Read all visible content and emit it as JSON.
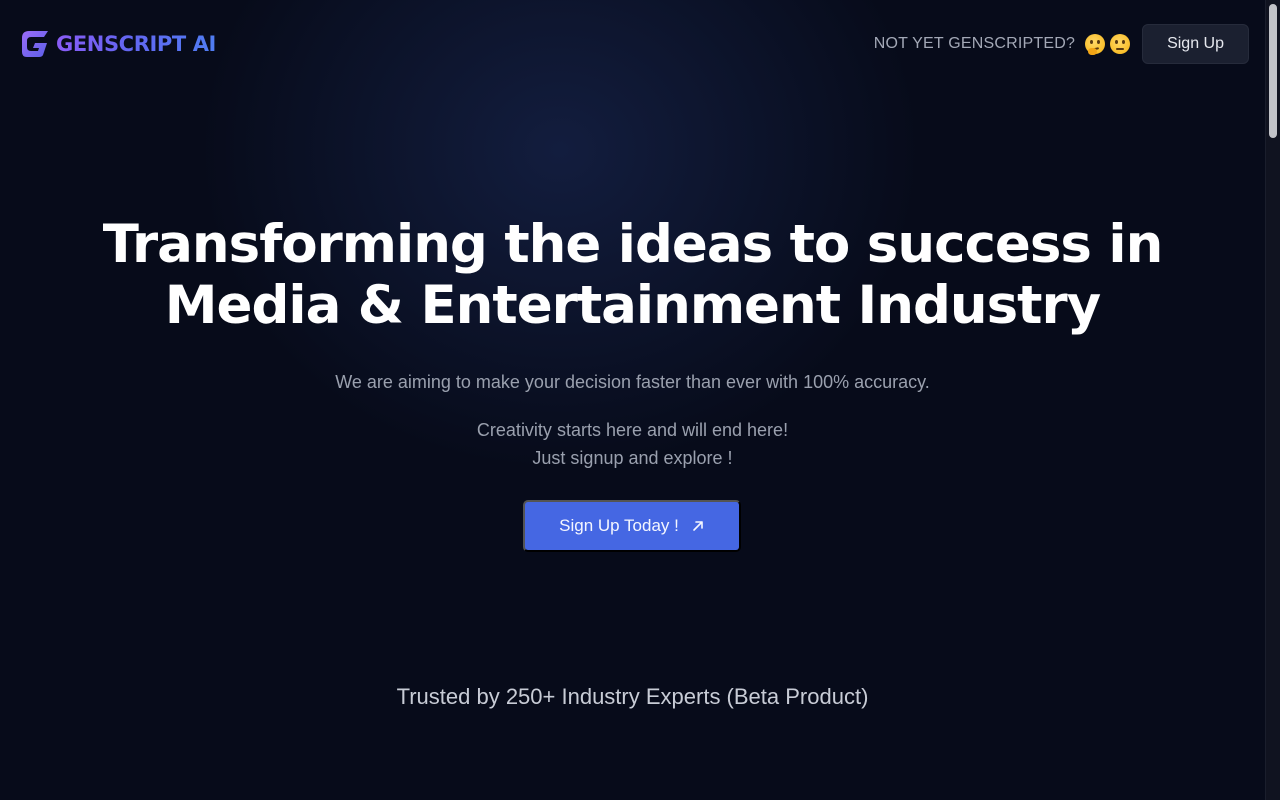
{
  "header": {
    "brand": "GENSCRIPT AI",
    "prompt_text": "NOT YET GENSCRIPTED?",
    "emojis": [
      "thinking-face-icon",
      "face-with-raised-eyebrow-icon"
    ],
    "signup_label": "Sign Up"
  },
  "hero": {
    "title_line1": "Transforming the ideas to success in",
    "title_line2": "Media & Entertainment Industry",
    "subtitle": "We are aiming to make your decision faster than ever with 100% accuracy.",
    "line1": "Creativity starts here and will end here!",
    "line2": "Just signup and explore !",
    "cta_label": "Sign Up Today !"
  },
  "trusted": {
    "text": "Trusted by 250+ Industry Experts (Beta Product)"
  },
  "colors": {
    "background": "#070b1a",
    "accent": "#4567e3",
    "brand_gradient_start": "#8a5cf6",
    "brand_gradient_end": "#4f7df2"
  }
}
